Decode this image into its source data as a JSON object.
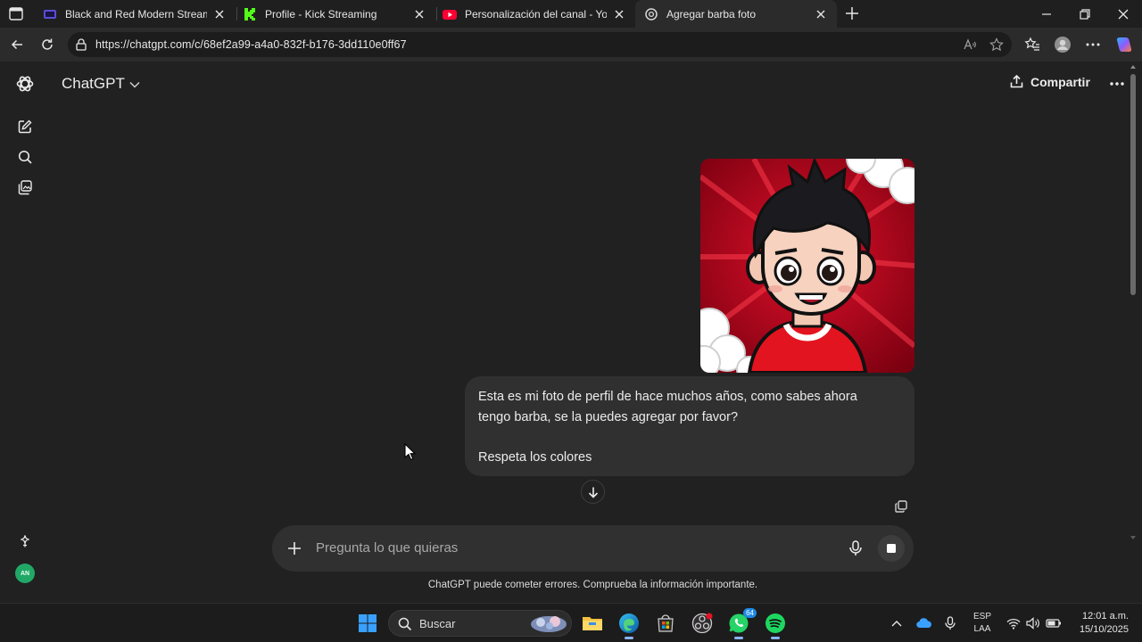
{
  "browser": {
    "tabs": [
      {
        "title": "Black and Red Modern Stream Tw",
        "favicon": "canva-icon",
        "active": false
      },
      {
        "title": "Profile - Kick Streaming",
        "favicon": "kick-icon",
        "active": false
      },
      {
        "title": "Personalización del canal - YouTu",
        "favicon": "youtube-icon",
        "active": false
      },
      {
        "title": "Agregar barba foto",
        "favicon": "chatgpt-icon",
        "active": true
      }
    ],
    "url": "https://chatgpt.com/c/68ef2a99-a4a0-832f-b176-3dd110e0ff67"
  },
  "app": {
    "brand": "ChatGPT",
    "share_label": "Compartir",
    "user_initials": "AN",
    "message": {
      "line1": "Esta es mi foto de perfil de hace muchos años, como sabes ahora",
      "line2": "tengo barba, se la puedes agregar por favor?",
      "line3": "Respeta los colores"
    },
    "composer": {
      "placeholder": "Pregunta lo que quieras"
    },
    "disclaimer": "ChatGPT puede cometer errores. Comprueba la información importante."
  },
  "taskbar": {
    "search_label": "Buscar",
    "whatsapp_badge": "64",
    "lang_top": "ESP",
    "lang_bottom": "LAA",
    "time": "12:01 a.m.",
    "date": "15/10/2025"
  },
  "colors": {
    "accent_red": "#c8102e",
    "user_avatar": "#21a867",
    "bubble": "#303030",
    "background": "#212121"
  }
}
